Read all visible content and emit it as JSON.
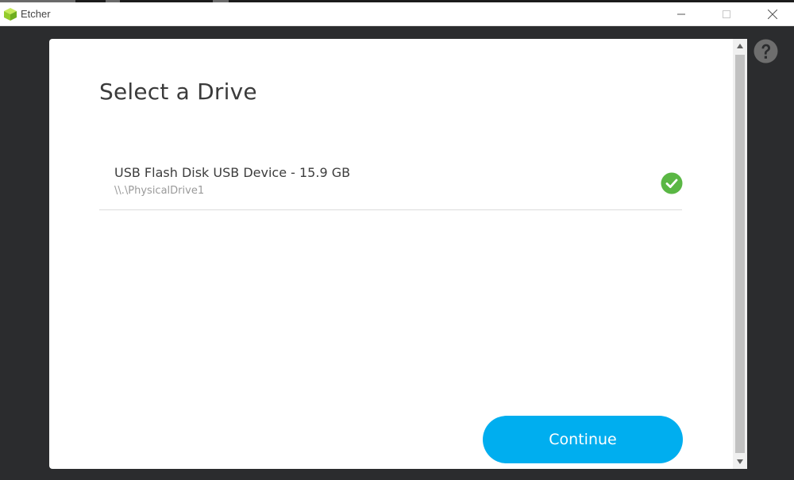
{
  "window": {
    "title": "Etcher",
    "minimize_icon": "minimize-icon",
    "maximize_icon": "maximize-icon",
    "close_icon": "close-icon"
  },
  "help": {
    "icon": "question-circle-icon"
  },
  "modal": {
    "title": "Select a Drive",
    "drives": [
      {
        "name": "USB Flash Disk USB Device - 15.9 GB",
        "path": "\\\\.\\PhysicalDrive1",
        "selected": true,
        "status_icon": "check-circle-icon"
      }
    ],
    "continue_label": "Continue"
  },
  "colors": {
    "accent": "#00aeef",
    "check": "#5ab744",
    "background": "#2b2c2e"
  }
}
